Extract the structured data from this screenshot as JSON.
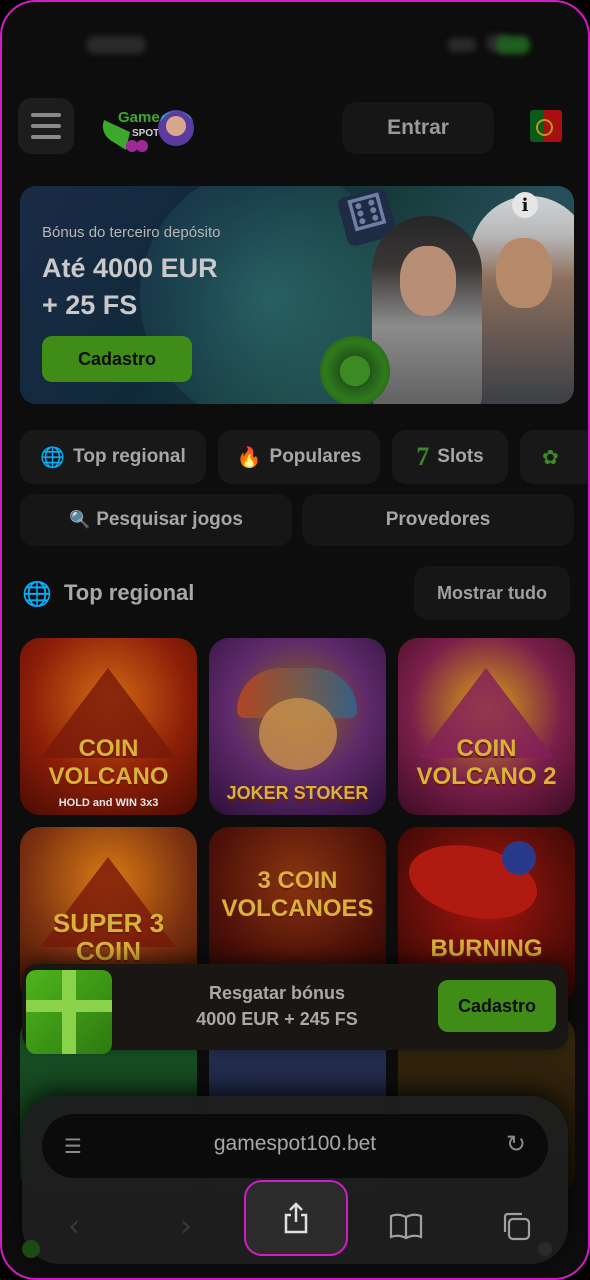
{
  "header": {
    "logo_alt": "Game Spot",
    "login_label": "Entrar",
    "menu_icon": "hamburger-icon",
    "flag_icon": "portugal-flag-icon"
  },
  "banner": {
    "subtitle": "Bónus do terceiro depósito",
    "title_line1": "Até 4000 EUR",
    "title_line2": "+ 25 FS",
    "cta_label": "Cadastro",
    "info_label": "i"
  },
  "categories": [
    {
      "label": "Top regional",
      "icon": "globe-icon",
      "glyph": "🌐"
    },
    {
      "label": "Populares",
      "icon": "fire-icon",
      "glyph": "🔥"
    },
    {
      "label": "Slots",
      "icon": "seven-icon",
      "glyph": "7"
    },
    {
      "label": "",
      "icon": "more-category-icon",
      "glyph": "✿"
    }
  ],
  "search": {
    "label": "Pesquisar jogos",
    "icon": "search-icon",
    "glyph": "🔍"
  },
  "providers": {
    "label": "Provedores"
  },
  "section": {
    "title": "Top regional",
    "more_label": "Mostrar tudo",
    "icon": "globe-icon",
    "glyph": "🌐"
  },
  "games": [
    {
      "title": "COIN VOLCANO",
      "subtitle": "HOLD and WIN 3x3"
    },
    {
      "title": "JOKER STOKER"
    },
    {
      "title": "COIN VOLCANO 2"
    },
    {
      "title": "SUPER 3 COIN"
    },
    {
      "title": "3 COIN VOLCANOES"
    },
    {
      "title": "BURNING"
    },
    {
      "title": ""
    },
    {
      "title": ""
    },
    {
      "title": ""
    }
  ],
  "bonus": {
    "line1": "Resgatar bónus",
    "line2": "4000 EUR + 245 FS",
    "cta_label": "Cadastro"
  },
  "browser": {
    "url": "gamespot100.bet",
    "reader_icon": "reader-icon",
    "reload_icon": "reload-icon",
    "back_icon": "back-arrow-icon",
    "forward_icon": "forward-arrow-icon",
    "share_icon": "share-icon",
    "bookmarks_icon": "bookmarks-icon",
    "tabs_icon": "tabs-icon"
  },
  "colors": {
    "accent": "#3f8c16",
    "highlight": "#d21cc4"
  }
}
